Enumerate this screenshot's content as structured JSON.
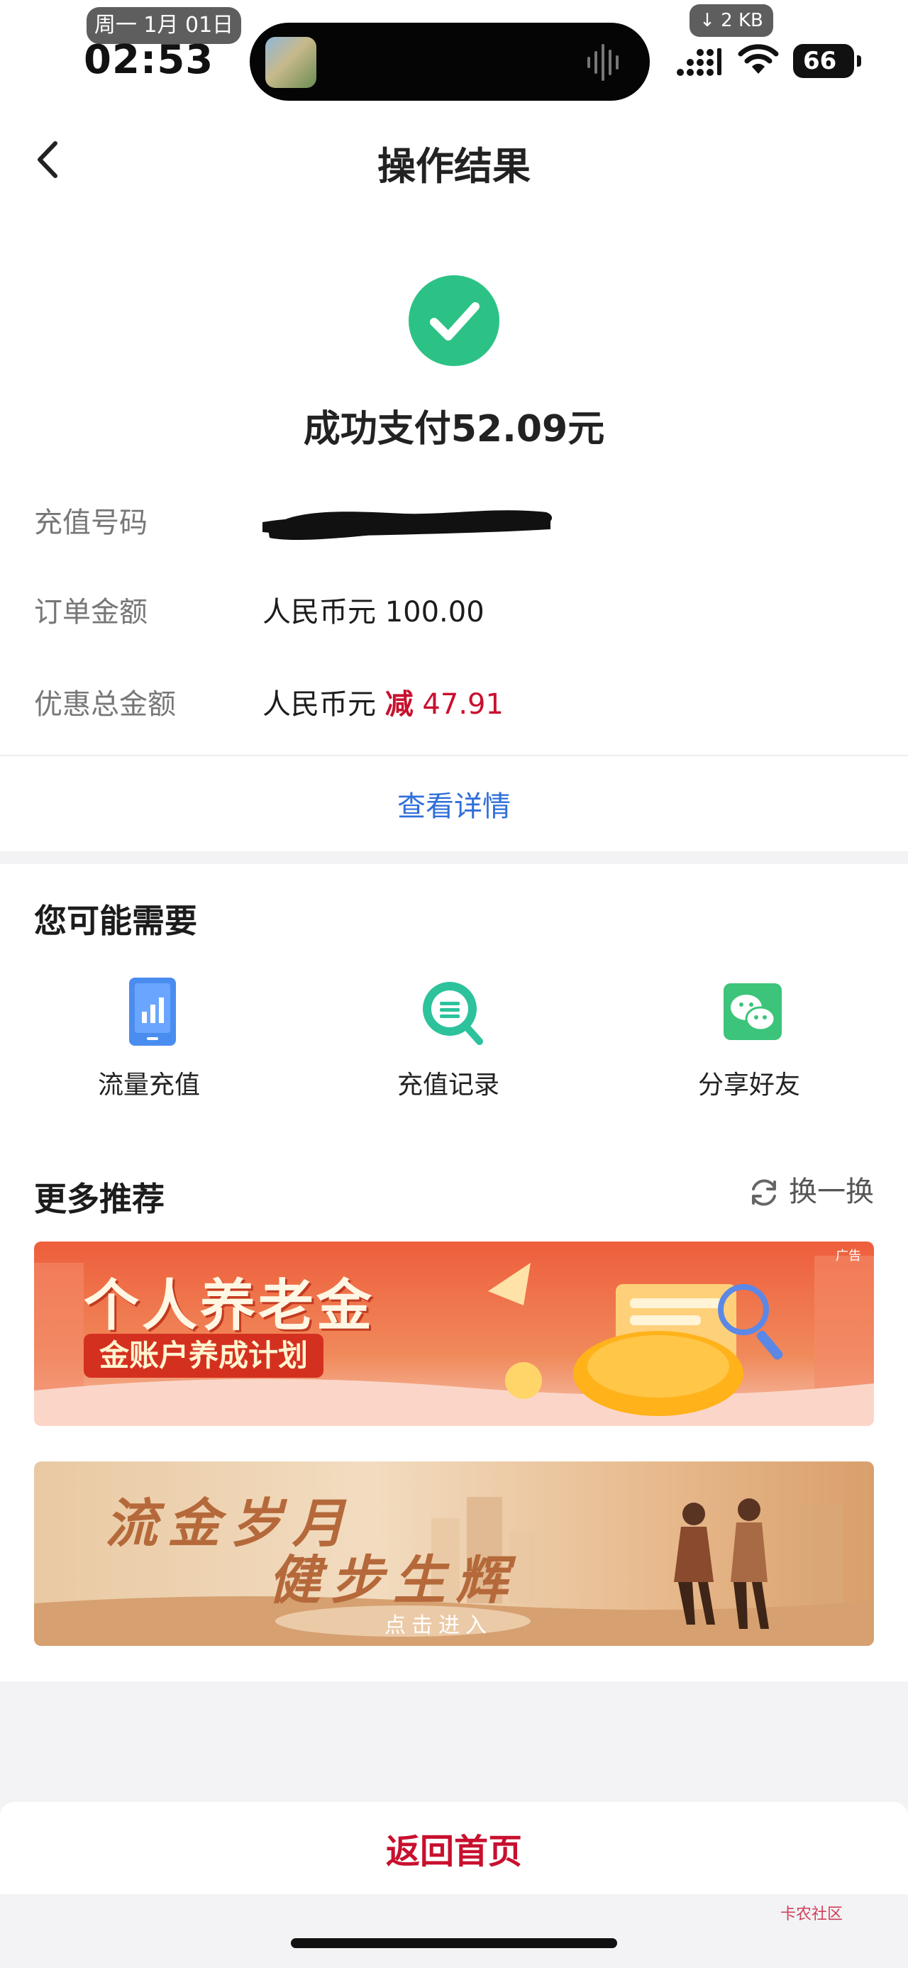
{
  "status_bar": {
    "date": "周一 1月 01日",
    "time": "02:53",
    "download": "↓ 2 KB",
    "battery": "66"
  },
  "nav": {
    "title": "操作结果"
  },
  "result": {
    "message": "成功支付52.09元",
    "rows": [
      {
        "label": "充值号码",
        "value": ""
      },
      {
        "label": "订单金额",
        "value": "人民币元 100.00"
      },
      {
        "label": "优惠总金额",
        "value_prefix": "人民币元 ",
        "minus": "减",
        "amount": " 47.91"
      }
    ],
    "details_link": "查看详情"
  },
  "needs": {
    "title": "您可能需要",
    "items": [
      {
        "label": "流量充值",
        "icon": "phone-data-icon"
      },
      {
        "label": "充值记录",
        "icon": "record-search-icon"
      },
      {
        "label": "分享好友",
        "icon": "wechat-icon"
      }
    ]
  },
  "recommend": {
    "title": "更多推荐",
    "refresh_label": "换一换",
    "banners": [
      {
        "ad_tag": "广告",
        "title": "个人养老金",
        "subtitle": "金账户养成计划"
      },
      {
        "line1": "流金岁月",
        "line2": "健步生辉",
        "cta": "点击进入"
      }
    ]
  },
  "bottom": {
    "home_button": "返回首页",
    "watermark": "卡农社区"
  },
  "colors": {
    "accent_red": "#c8102e",
    "link_blue": "#2f6fd9",
    "success_green": "#2cc286"
  }
}
